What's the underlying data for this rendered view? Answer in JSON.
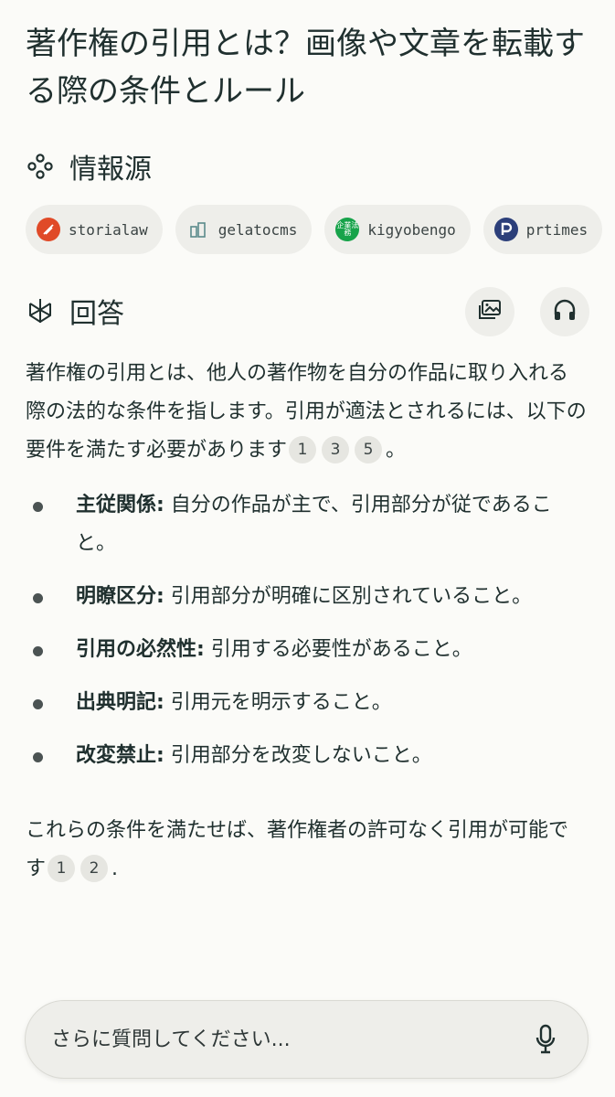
{
  "title": "著作権の引用とは？画像や文章を転載する際の条件とルール",
  "sources": {
    "heading": "情報源",
    "items": [
      {
        "label": "storialaw",
        "icon": "storialaw-favicon"
      },
      {
        "label": "gelatocms",
        "icon": "gelatocms-favicon"
      },
      {
        "label": "kigyobengo",
        "icon": "kigyobengo-favicon",
        "badge": "企業法務"
      },
      {
        "label": "prtimes",
        "icon": "prtimes-favicon"
      }
    ]
  },
  "answer": {
    "heading": "回答",
    "intro": "著作権の引用とは、他人の著作物を自分の作品に取り入れる際の法的な条件を指します。引用が適法とされるには、以下の要件を満たす必要があります",
    "intro_cites": [
      "1",
      "3",
      "5"
    ],
    "intro_end": "。",
    "bullets": [
      {
        "term": "主従関係:",
        "text": " 自分の作品が主で、引用部分が従であること。"
      },
      {
        "term": "明瞭区分:",
        "text": " 引用部分が明確に区別されていること。"
      },
      {
        "term": "引用の必然性:",
        "text": " 引用する必要性があること。"
      },
      {
        "term": "出典明記:",
        "text": " 引用元を明示すること。"
      },
      {
        "term": "改変禁止:",
        "text": " 引用部分を改変しないこと。"
      }
    ],
    "closing": "これらの条件を満たせば、著作権者の許可なく引用が可能です",
    "closing_cites": [
      "1",
      "2"
    ],
    "closing_end": "."
  },
  "followup": {
    "placeholder": "さらに質問してください..."
  },
  "colors": {
    "background": "#fbfbf8",
    "chip": "#eeeeea",
    "text": "#20302f"
  }
}
